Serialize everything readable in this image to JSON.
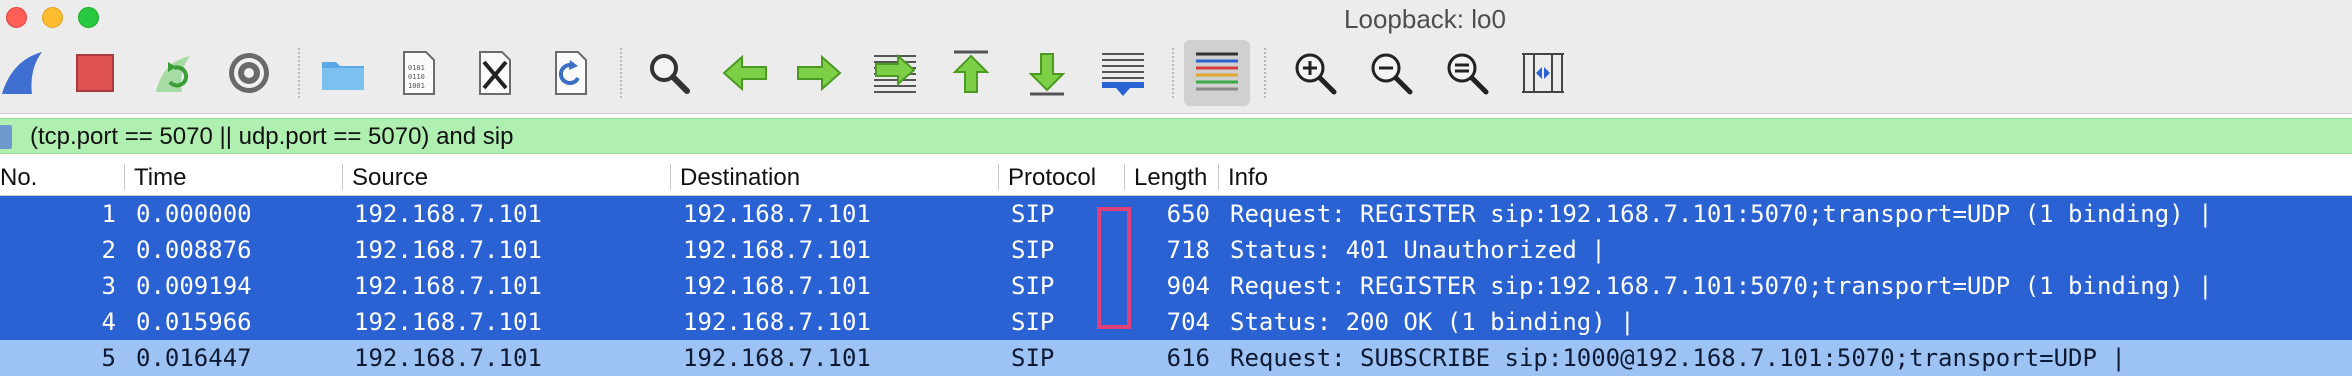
{
  "window": {
    "title": "Loopback: lo0"
  },
  "toolbar": {
    "buttons": [
      {
        "icon": "shark-fin-icon"
      },
      {
        "icon": "stop-capture-icon"
      },
      {
        "icon": "restart-capture-icon"
      },
      {
        "icon": "capture-options-icon"
      },
      {
        "icon": "open-file-icon"
      },
      {
        "icon": "save-file-icon"
      },
      {
        "icon": "close-file-icon"
      },
      {
        "icon": "reload-file-icon"
      },
      {
        "icon": "find-packet-icon"
      },
      {
        "icon": "go-back-icon"
      },
      {
        "icon": "go-forward-icon"
      },
      {
        "icon": "go-to-packet-icon"
      },
      {
        "icon": "go-first-packet-icon"
      },
      {
        "icon": "go-last-packet-icon"
      },
      {
        "icon": "auto-scroll-icon"
      },
      {
        "icon": "colorize-icon"
      },
      {
        "icon": "zoom-in-icon"
      },
      {
        "icon": "zoom-out-icon"
      },
      {
        "icon": "zoom-reset-icon"
      },
      {
        "icon": "resize-columns-icon"
      }
    ]
  },
  "filter": {
    "text": "(tcp.port == 5070 || udp.port == 5070) and sip"
  },
  "columns": {
    "no": "No.",
    "time": "Time",
    "source": "Source",
    "destination": "Destination",
    "protocol": "Protocol",
    "length": "Length",
    "info": "Info"
  },
  "packets": [
    {
      "no": "1",
      "time": "0.000000",
      "source": "192.168.7.101",
      "destination": "192.168.7.101",
      "protocol": "SIP",
      "length": "650",
      "info": "Request: REGISTER sip:192.168.7.101:5070;transport=UDP  (1 binding) |"
    },
    {
      "no": "2",
      "time": "0.008876",
      "source": "192.168.7.101",
      "destination": "192.168.7.101",
      "protocol": "SIP",
      "length": "718",
      "info": "Status: 401 Unauthorized |"
    },
    {
      "no": "3",
      "time": "0.009194",
      "source": "192.168.7.101",
      "destination": "192.168.7.101",
      "protocol": "SIP",
      "length": "904",
      "info": "Request: REGISTER sip:192.168.7.101:5070;transport=UDP  (1 binding) |"
    },
    {
      "no": "4",
      "time": "0.015966",
      "source": "192.168.7.101",
      "destination": "192.168.7.101",
      "protocol": "SIP",
      "length": "704",
      "info": "Status: 200 OK  (1 binding) |"
    },
    {
      "no": "5",
      "time": "0.016447",
      "source": "192.168.7.101",
      "destination": "192.168.7.101",
      "protocol": "SIP",
      "length": "616",
      "info": "Request: SUBSCRIBE sip:1000@192.168.7.101:5070;transport=UDP |"
    }
  ],
  "colors": {
    "selected_row": "#2a62d4",
    "filter_valid": "#afefaf",
    "annotation": "#e0407a"
  }
}
